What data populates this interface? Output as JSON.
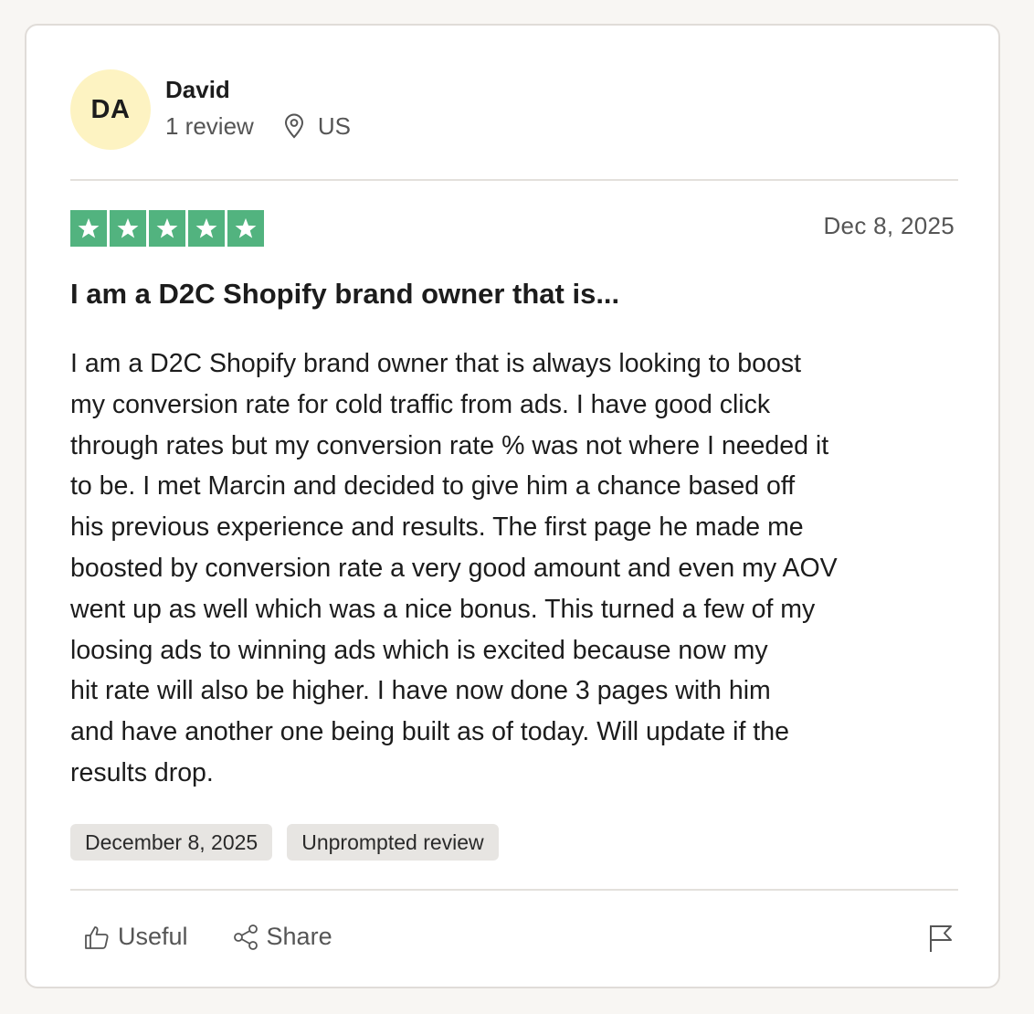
{
  "user": {
    "initials": "DA",
    "name": "David",
    "review_count": "1 review",
    "location": "US"
  },
  "review": {
    "rating": 5,
    "date": "Dec 8, 2025",
    "title": "I am a D2C Shopify brand owner that is...",
    "body_lines": [
      "I am a D2C Shopify brand owner that is always looking to boost",
      "my conversion rate for cold traffic from ads. I have good click",
      "through rates but my conversion rate % was not where I needed it",
      "to be. I met Marcin and decided to give him a chance based off",
      "his previous experience and results. The first page he made me",
      "boosted by conversion rate a very good amount and even my AOV",
      "went up as well which was a nice bonus. This turned a few of my",
      "loosing ads to winning ads which is excited because now my",
      "hit rate will also be higher. I have now done 3 pages with him",
      "and have another one being built as of today. Will update if the",
      "results drop."
    ],
    "tags": [
      "December 8, 2025",
      "Unprompted review"
    ]
  },
  "actions": {
    "useful_label": "Useful",
    "share_label": "Share"
  },
  "colors": {
    "star_green": "#52b37f",
    "avatar_bg": "#fdf3c2",
    "tag_bg": "#e7e5e2"
  },
  "icons": [
    "location-pin-icon",
    "star-icon",
    "thumbs-up-icon",
    "share-icon",
    "flag-icon"
  ]
}
